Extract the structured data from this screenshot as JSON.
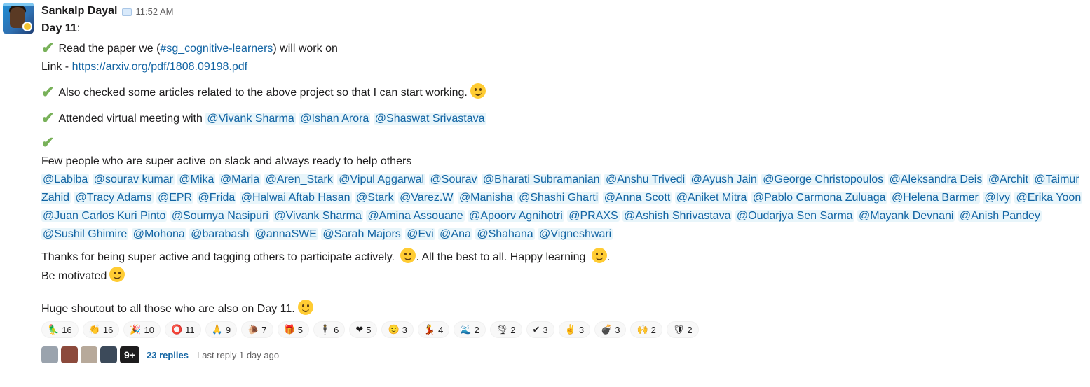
{
  "message": {
    "sender": "Sankalp Dayal",
    "time": "11:52 AM",
    "day_label": "Day 11",
    "lines": {
      "read_pre": "Read the paper we (",
      "channel": "#sg_cognitive-learners",
      "read_post": ") will work on",
      "link_pre": "Link - ",
      "link_url": "https://arxiv.org/pdf/1808.09198.pdf",
      "articles": "Also checked some articles related to the above project so that I can start working.",
      "meeting": "Attended virtual meeting with",
      "few_people": "Few people who are super active on slack and always ready to help others",
      "thanks_a": "Thanks for being super active and tagging others to participate actively.",
      "thanks_b": ". All the best to all. Happy learning",
      "thanks_c": ".",
      "motivated": "Be motivated",
      "shoutout": "Huge shoutout to all those who are also on Day 11."
    },
    "meeting_mentions": [
      "@Vivank Sharma",
      "@Ishan Arora",
      "@Shaswat Srivastava"
    ],
    "mentions": [
      "@Labiba",
      "@sourav kumar",
      "@Mika",
      "@Maria",
      "@Aren_Stark",
      "@Vipul Aggarwal",
      "@Sourav",
      "@Bharati Subramanian",
      "@Anshu Trivedi",
      "@Ayush Jain",
      "@George Christopoulos",
      "@Aleksandra Deis",
      "@Archit",
      "@Taimur Zahid",
      "@Tracy Adams",
      "@EPR",
      "@Frida",
      "@Halwai Aftab Hasan",
      "@Stark",
      "@Varez.W",
      "@Manisha",
      "@Shashi Gharti",
      "@Anna Scott",
      "@Aniket Mitra",
      "@Pablo Carmona Zuluaga",
      "@Helena Barmer",
      "@Ivy",
      "@Erika Yoon",
      "@Juan Carlos Kuri Pinto",
      "@Soumya Nasipuri",
      "@Vivank Sharma",
      "@Amina Assouane",
      "@Apoorv Agnihotri",
      "@PRAXS",
      "@Ashish Shrivastava",
      "@Oudarjya Sen Sarma",
      "@Mayank Devnani",
      "@Anish Pandey",
      "@Sushil Ghimire",
      "@Mohona",
      "@barabash",
      "@annaSWE",
      "@Sarah Majors",
      "@Evi",
      "@Ana",
      "@Shahana",
      "@Vigneshwari"
    ]
  },
  "reactions": [
    {
      "icon": "parrot-icon",
      "glyph": "🦜",
      "count": "16"
    },
    {
      "icon": "clap-icon",
      "glyph": "👏",
      "count": "16"
    },
    {
      "icon": "party-icon",
      "glyph": "🎉",
      "count": "10"
    },
    {
      "icon": "blob-icon",
      "glyph": "⭕",
      "count": "11"
    },
    {
      "icon": "thank-you-icon",
      "glyph": "🙏",
      "count": "9"
    },
    {
      "icon": "snail-icon",
      "glyph": "🐌",
      "count": "7"
    },
    {
      "icon": "gift-icon",
      "glyph": "🎁",
      "count": "5"
    },
    {
      "icon": "person-icon",
      "glyph": "🕴",
      "count": "6"
    },
    {
      "icon": "heart-icon",
      "glyph": "❤",
      "count": "5"
    },
    {
      "icon": "smile-icon",
      "glyph": "🙂",
      "count": "3"
    },
    {
      "icon": "dance-icon",
      "glyph": "💃",
      "count": "4"
    },
    {
      "icon": "wave-icon",
      "glyph": "🌊",
      "count": "2"
    },
    {
      "icon": "tornado-icon",
      "glyph": "🌪",
      "count": "2"
    },
    {
      "icon": "check-icon",
      "glyph": "✔",
      "count": "3"
    },
    {
      "icon": "victory-icon",
      "glyph": "✌",
      "count": "3"
    },
    {
      "icon": "bomb-icon",
      "glyph": "💣",
      "count": "3"
    },
    {
      "icon": "raised-hands-icon",
      "glyph": "🙌",
      "count": "2"
    },
    {
      "icon": "shield-icon",
      "glyph": "🛡",
      "count": "2"
    }
  ],
  "thread": {
    "more_count": "9+",
    "replies": "23 replies",
    "last_reply": "Last reply 1 day ago",
    "avatar_colors": [
      "#9aa3ad",
      "#8c4a3c",
      "#b7a99a",
      "#3c4a5a"
    ]
  },
  "colors": {
    "link": "#1264a3",
    "mention_bg": "#e8f5fa",
    "check": "#78b159"
  }
}
